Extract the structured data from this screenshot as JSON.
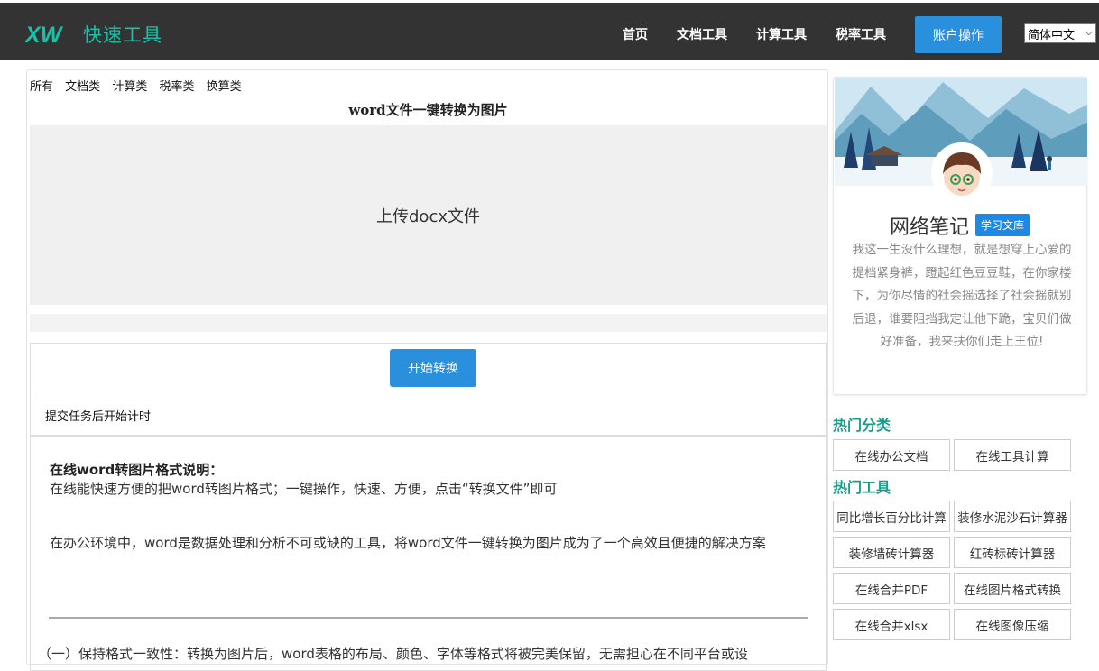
{
  "header": {
    "logo_mark": "XW",
    "logo_text": "快速工具",
    "nav": [
      "首页",
      "文档工具",
      "计算工具",
      "税率工具"
    ],
    "account_button": "账户操作",
    "language": "简体中文"
  },
  "main": {
    "categories": [
      "所有",
      "文档类",
      "计算类",
      "税率类",
      "换算类"
    ],
    "tool_title": "word文件一键转换为图片",
    "upload_label": "上传docx文件",
    "start_button": "开始转换",
    "timer_text": "提交任务后开始计时",
    "article": {
      "heading": "在线word转图片格式说明：",
      "p1": "在线能快速方便的把word转图片格式；一键操作，快速、方便，点击“转换文件”即可",
      "p2": "在办公环境中，word是数据处理和分析不可或缺的工具，将word文件一键转换为图片成为了一个高效且便捷的解决方案",
      "p3": "（一）保持格式一致性：转换为图片后，word表格的布局、颜色、字体等格式将被完美保留，无需担心在不同平台或设"
    }
  },
  "sidebar": {
    "profile_name": "网络笔记",
    "profile_tag": "学习文库",
    "profile_desc": "我这一生没什么理想，就是想穿上心爱的提档紧身裤，蹬起红色豆豆鞋，在你家楼下，为你尽情的社会摇选择了社会摇就别后退，谁要阻挡我定让他下跪，宝贝们做好准备，我来扶你们走上王位!",
    "hot_categories_title": "热门分类",
    "hot_categories": [
      "在线办公文档",
      "在线工具计算"
    ],
    "hot_tools_title": "热门工具",
    "hot_tools": [
      "同比增长百分比计算",
      "装修水泥沙石计算器",
      "装修墙砖计算器",
      "红砖标砖计算器",
      "在线合并PDF",
      "在线图片格式转换",
      "在线合并xlsx",
      "在线图像压缩"
    ]
  },
  "colors": {
    "header_bg": "#333333",
    "accent_teal": "#19c1a8",
    "button_blue": "#2a8fdc",
    "section_teal": "#1a9b8c"
  }
}
